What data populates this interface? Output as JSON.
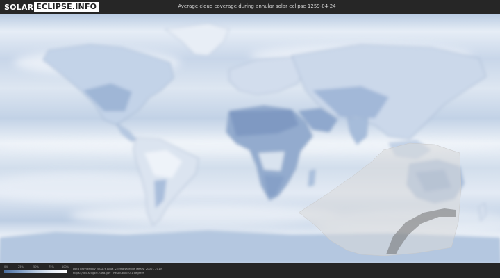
{
  "header": {
    "logo_part1": "SOLAR",
    "logo_part2": "ECLIPSE.INFO",
    "title": "Average cloud coverage during annular solar eclipse 1259-04-24"
  },
  "colors": {
    "cloud_dense": "#4c6f9e",
    "cloud_clear": "#ffffff",
    "eclipse_overlay": "#d9d9d9"
  },
  "map": {
    "kind": "cloud-coverage-world-map",
    "eclipse_path_region": "southern-indian-ocean-australia"
  },
  "footer": {
    "legend_ticks": [
      "0%",
      "25%",
      "50%",
      "75%",
      "100%"
    ],
    "credit_line1": "Data provided by NASA's Aqua & Terra satellite (Years: 2000 - 2019)",
    "credit_line2": "https://neo.sci.gsfc.nasa.gov | Resolution: 0.1 degrees"
  }
}
